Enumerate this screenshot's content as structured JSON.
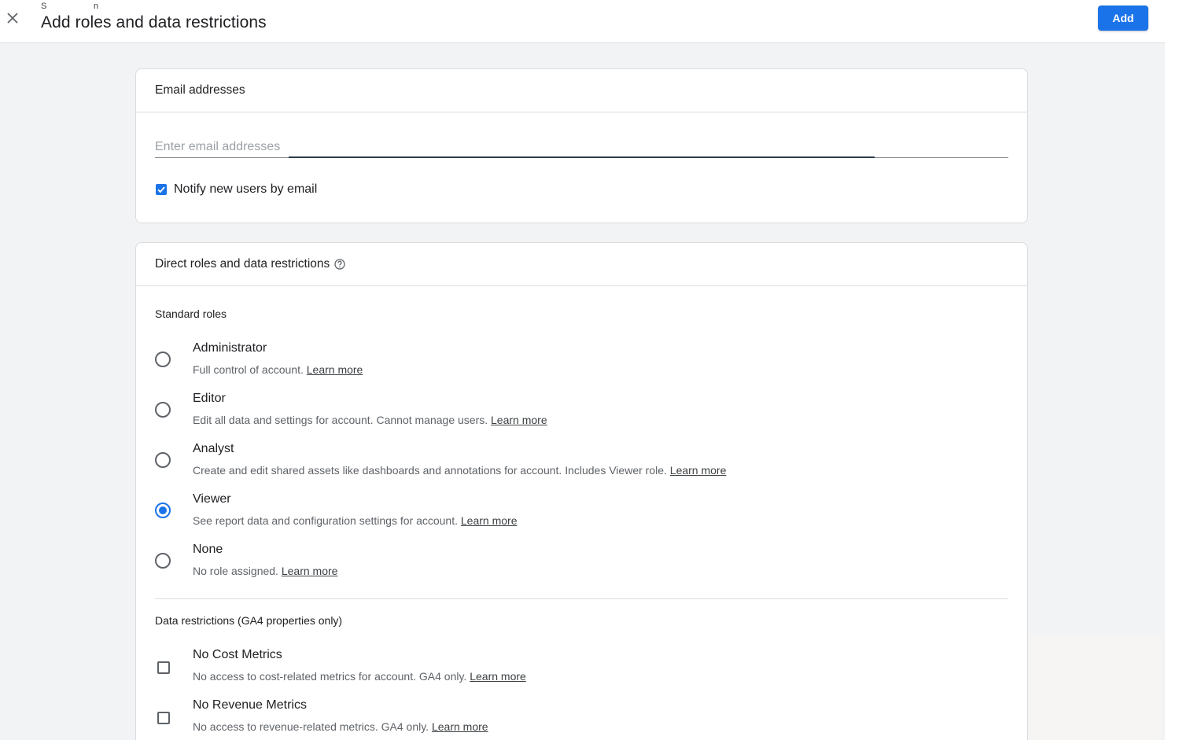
{
  "header": {
    "title": "Add roles and data restrictions",
    "tiny_letters": [
      "S",
      "n"
    ],
    "add_label": "Add"
  },
  "email_card": {
    "title": "Email addresses",
    "input_placeholder": "Enter email addresses",
    "input_value": "",
    "notify_label": "Notify new users by email",
    "notify_checked": true
  },
  "roles_card": {
    "title": "Direct roles and data restrictions",
    "standard_roles_label": "Standard roles",
    "roles": [
      {
        "title": "Administrator",
        "desc": "Full control of account.",
        "link": "Learn more",
        "selected": false
      },
      {
        "title": "Editor",
        "desc": "Edit all data and settings for account. Cannot manage users.",
        "link": "Learn more",
        "selected": false
      },
      {
        "title": "Analyst",
        "desc": "Create and edit shared assets like dashboards and annotations for account. Includes Viewer role.",
        "link": "Learn more",
        "selected": false
      },
      {
        "title": "Viewer",
        "desc": "See report data and configuration settings for account.",
        "link": "Learn more",
        "selected": true
      },
      {
        "title": "None",
        "desc": "No role assigned.",
        "link": "Learn more",
        "selected": false
      }
    ],
    "data_restrictions_label": "Data restrictions (GA4 properties only)",
    "restrictions": [
      {
        "title": "No Cost Metrics",
        "desc": "No access to cost-related metrics for account. GA4 only.",
        "link": "Learn more",
        "checked": false
      },
      {
        "title": "No Revenue Metrics",
        "desc": "No access to revenue-related metrics. GA4 only.",
        "link": "Learn more",
        "checked": false
      }
    ]
  },
  "colors": {
    "accent": "#1a73e8",
    "background": "#f1f3f4",
    "border": "#dadce0"
  },
  "icons": {
    "close": "close-icon",
    "help": "help-circle-icon",
    "check": "check-icon"
  }
}
